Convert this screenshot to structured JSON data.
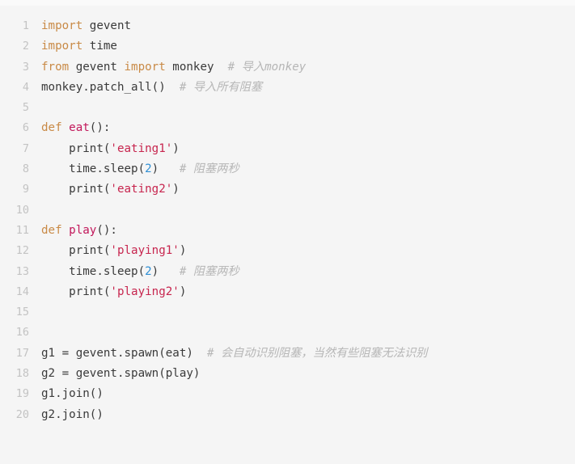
{
  "editor": {
    "language": "python",
    "background_color": "#f5f5f5",
    "gutter_color": "#c3c3c3",
    "total_lines": 20
  },
  "theme": {
    "keyword_color": "#c98a46",
    "function_color": "#c2185b",
    "string_color": "#c7254e",
    "number_color": "#2f8fd4",
    "plain_color": "#3a3a3a",
    "comment_color": "#b6b6b6"
  },
  "lines": [
    {
      "number": "1",
      "tokens": [
        {
          "type": "kw",
          "text": "import"
        },
        {
          "type": "plain",
          "text": " gevent"
        }
      ]
    },
    {
      "number": "2",
      "tokens": [
        {
          "type": "kw",
          "text": "import"
        },
        {
          "type": "plain",
          "text": " time"
        }
      ]
    },
    {
      "number": "3",
      "tokens": [
        {
          "type": "kw",
          "text": "from"
        },
        {
          "type": "plain",
          "text": " gevent "
        },
        {
          "type": "kw",
          "text": "import"
        },
        {
          "type": "plain",
          "text": " monkey  "
        },
        {
          "type": "comment",
          "text": "# 导入monkey"
        }
      ]
    },
    {
      "number": "4",
      "tokens": [
        {
          "type": "plain",
          "text": "monkey.patch_all()  "
        },
        {
          "type": "comment",
          "text": "# 导入所有阻塞"
        }
      ]
    },
    {
      "number": "5",
      "tokens": []
    },
    {
      "number": "6",
      "tokens": [
        {
          "type": "kw",
          "text": "def"
        },
        {
          "type": "plain",
          "text": " "
        },
        {
          "type": "fn",
          "text": "eat"
        },
        {
          "type": "plain",
          "text": "():"
        }
      ]
    },
    {
      "number": "7",
      "tokens": [
        {
          "type": "plain",
          "text": "    print("
        },
        {
          "type": "str",
          "text": "'eating1'"
        },
        {
          "type": "plain",
          "text": ")"
        }
      ]
    },
    {
      "number": "8",
      "tokens": [
        {
          "type": "plain",
          "text": "    time.sleep("
        },
        {
          "type": "num",
          "text": "2"
        },
        {
          "type": "plain",
          "text": ")   "
        },
        {
          "type": "comment",
          "text": "# 阻塞两秒"
        }
      ]
    },
    {
      "number": "9",
      "tokens": [
        {
          "type": "plain",
          "text": "    print("
        },
        {
          "type": "str",
          "text": "'eating2'"
        },
        {
          "type": "plain",
          "text": ")"
        }
      ]
    },
    {
      "number": "10",
      "tokens": []
    },
    {
      "number": "11",
      "tokens": [
        {
          "type": "kw",
          "text": "def"
        },
        {
          "type": "plain",
          "text": " "
        },
        {
          "type": "fn",
          "text": "play"
        },
        {
          "type": "plain",
          "text": "():"
        }
      ]
    },
    {
      "number": "12",
      "tokens": [
        {
          "type": "plain",
          "text": "    print("
        },
        {
          "type": "str",
          "text": "'playing1'"
        },
        {
          "type": "plain",
          "text": ")"
        }
      ]
    },
    {
      "number": "13",
      "tokens": [
        {
          "type": "plain",
          "text": "    time.sleep("
        },
        {
          "type": "num",
          "text": "2"
        },
        {
          "type": "plain",
          "text": ")   "
        },
        {
          "type": "comment",
          "text": "# 阻塞两秒"
        }
      ]
    },
    {
      "number": "14",
      "tokens": [
        {
          "type": "plain",
          "text": "    print("
        },
        {
          "type": "str",
          "text": "'playing2'"
        },
        {
          "type": "plain",
          "text": ")"
        }
      ]
    },
    {
      "number": "15",
      "tokens": []
    },
    {
      "number": "16",
      "tokens": []
    },
    {
      "number": "17",
      "tokens": [
        {
          "type": "plain",
          "text": "g1 = gevent.spawn(eat)  "
        },
        {
          "type": "comment",
          "text": "# 会自动识别阻塞，当然有些阻塞无法识别"
        }
      ]
    },
    {
      "number": "18",
      "tokens": [
        {
          "type": "plain",
          "text": "g2 = gevent.spawn(play)"
        }
      ]
    },
    {
      "number": "19",
      "tokens": [
        {
          "type": "plain",
          "text": "g1.join()"
        }
      ]
    },
    {
      "number": "20",
      "tokens": [
        {
          "type": "plain",
          "text": "g2.join()"
        }
      ]
    }
  ]
}
